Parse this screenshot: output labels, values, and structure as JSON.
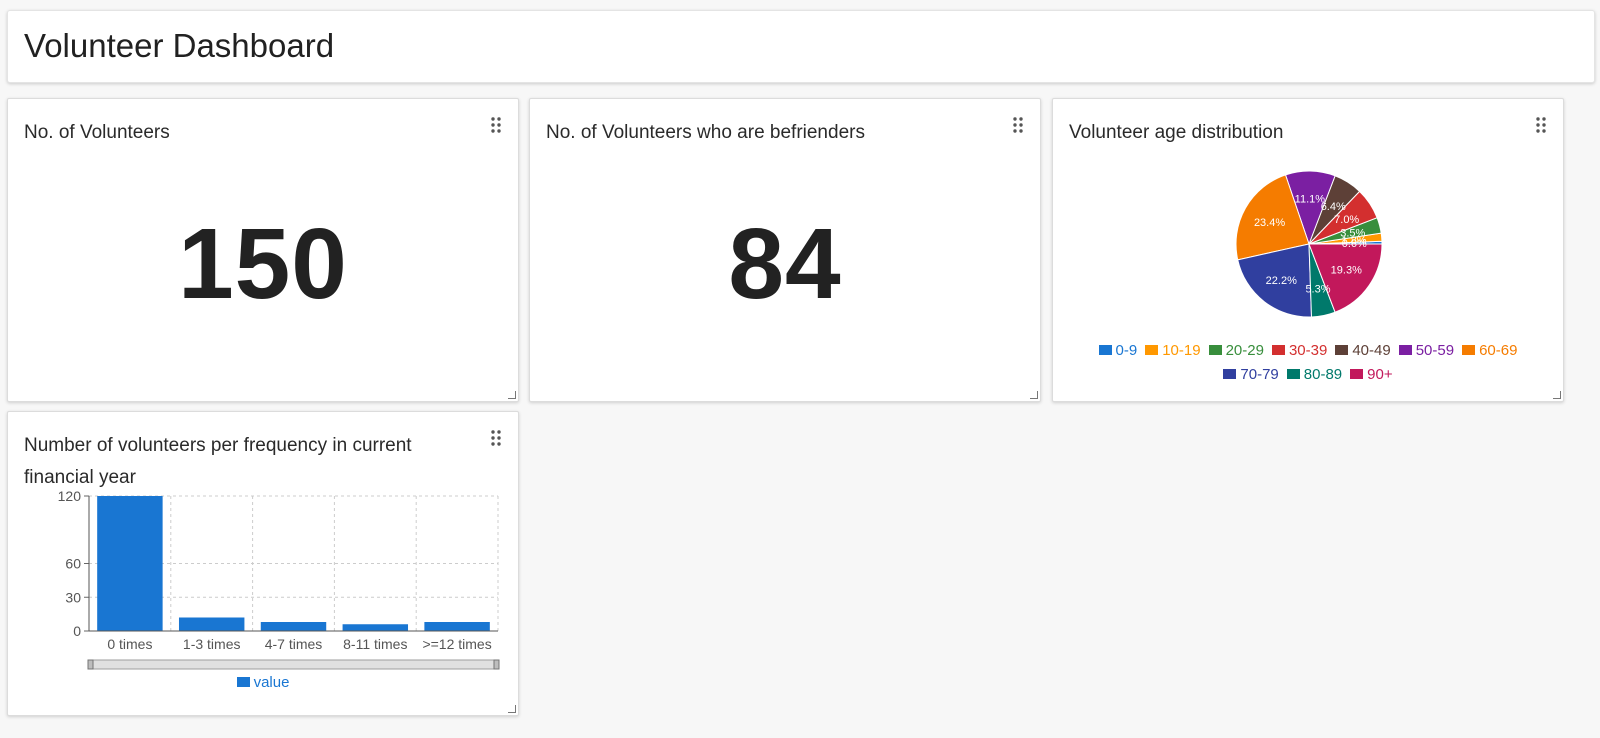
{
  "header": {
    "title": "Volunteer Dashboard"
  },
  "widgets": {
    "volunteers": {
      "title": "No. of Volunteers",
      "value": "150"
    },
    "befrienders": {
      "title": "No. of Volunteers who are befrienders",
      "value": "84"
    },
    "age": {
      "title": "Volunteer age distribution"
    },
    "frequency": {
      "title": "Number of volunteers per frequency in current financial year"
    }
  },
  "chart_data": [
    {
      "type": "pie",
      "categories": [
        "0-9",
        "10-19",
        "20-29",
        "30-39",
        "40-49",
        "50-59",
        "60-69",
        "70-79",
        "80-89",
        "90+"
      ],
      "values": [
        0.6,
        1.8,
        3.5,
        7.0,
        6.4,
        11.1,
        23.4,
        22.2,
        5.3,
        19.3
      ],
      "labels": [
        "0.6%",
        "1.8%",
        "3.5%",
        "7.0%",
        "6.4%",
        "11.1%",
        "23.4%",
        "22.2%",
        "5.3%",
        "19.3%"
      ],
      "colors": [
        "#1976d2",
        "#ff9800",
        "#388e3c",
        "#d32f2f",
        "#5d4037",
        "#7b1fa2",
        "#f57c00",
        "#303f9f",
        "#00796b",
        "#c2185b"
      ],
      "legend": "bottom"
    },
    {
      "type": "bar",
      "categories": [
        "0 times",
        "1-3 times",
        "4-7 times",
        "8-11 times",
        ">=12 times"
      ],
      "series": [
        {
          "name": "value",
          "values": [
            120,
            12,
            8,
            6,
            8
          ],
          "color": "#1976d2"
        }
      ],
      "yticks": [
        "0",
        "30",
        "60",
        "120"
      ],
      "ytick_values": [
        0,
        30,
        60,
        120
      ],
      "ylim": [
        0,
        120
      ],
      "grid": true,
      "legend": "bottom"
    }
  ]
}
